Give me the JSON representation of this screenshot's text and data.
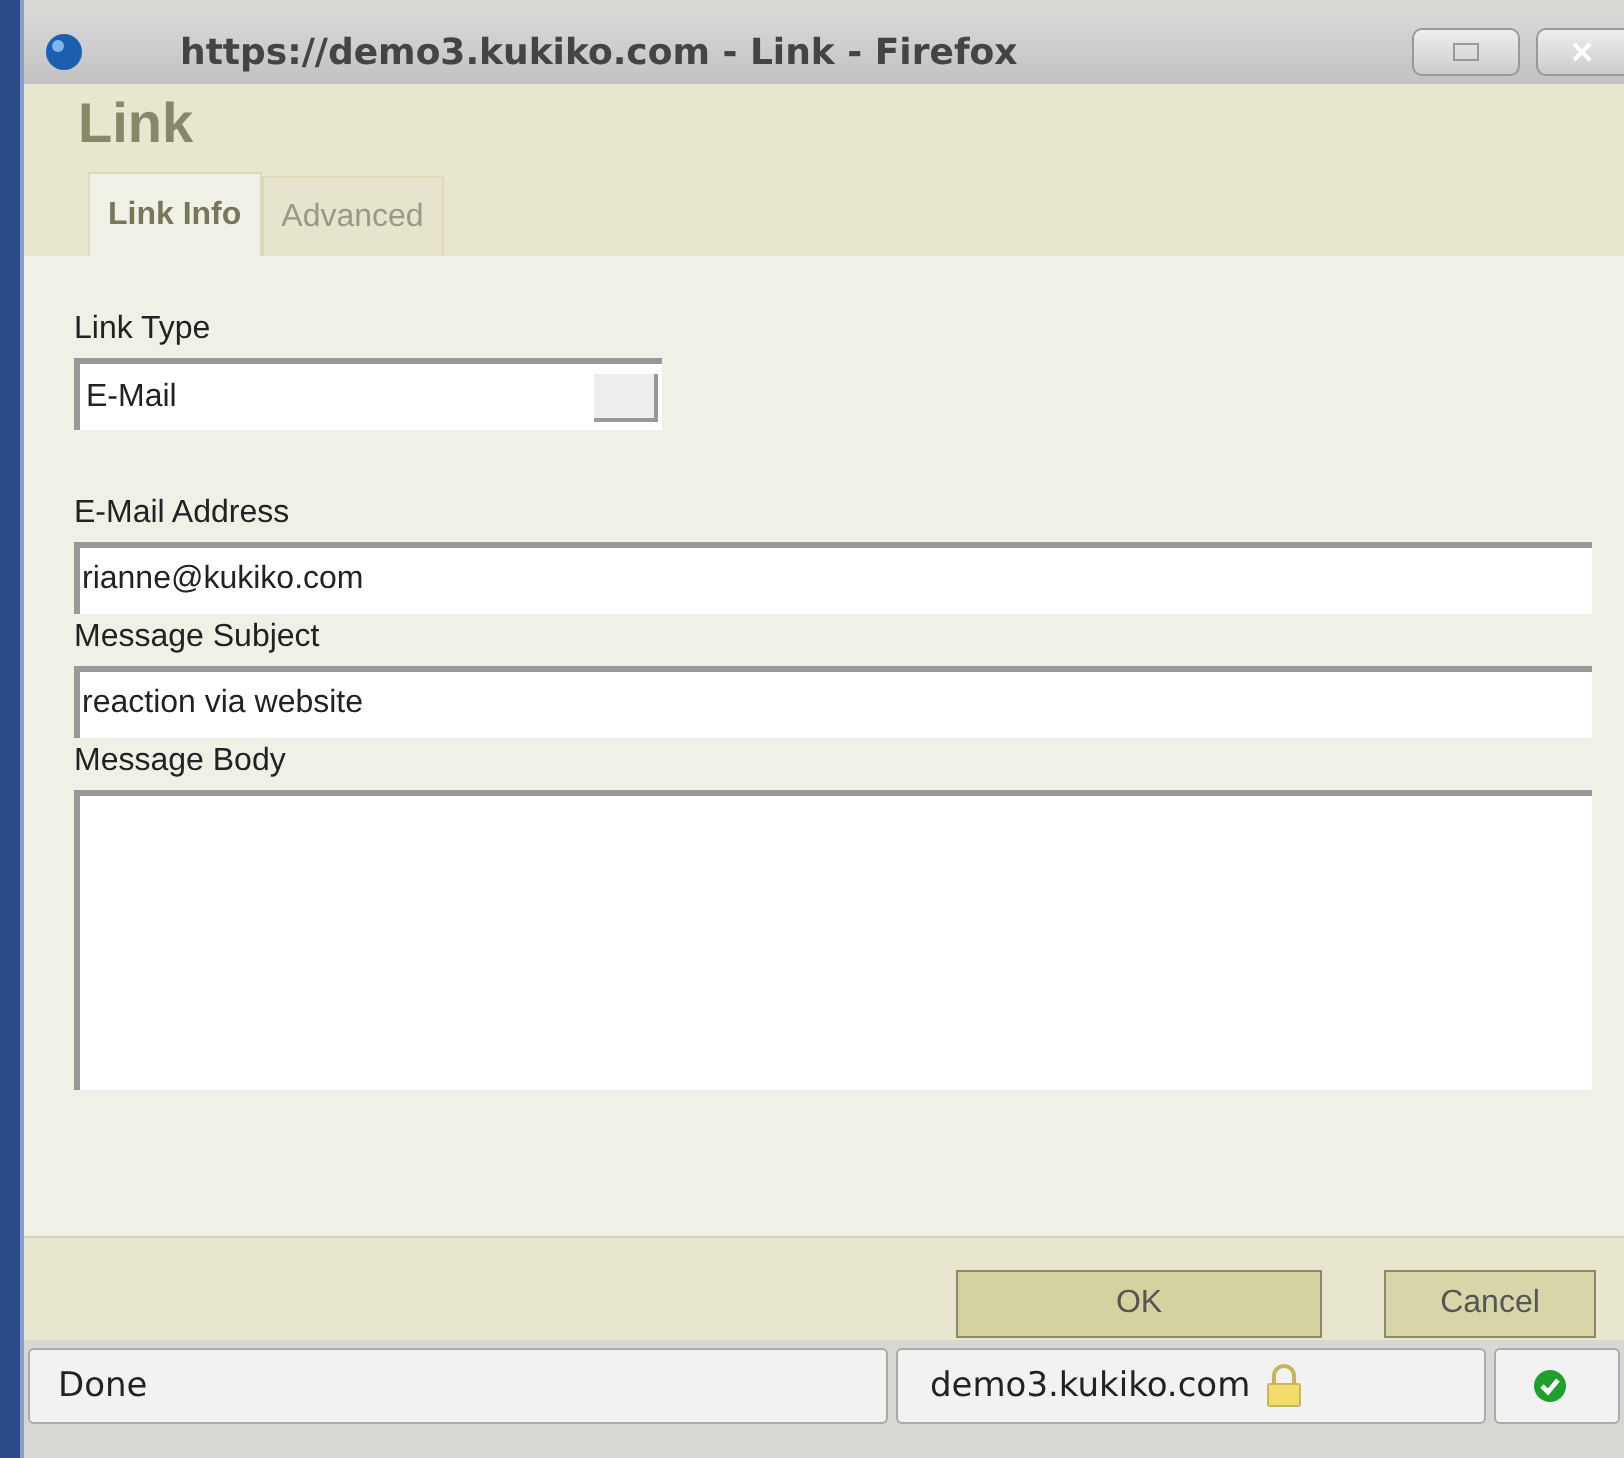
{
  "window": {
    "title": "https://demo3.kukiko.com - Link - Firefox"
  },
  "dialog": {
    "title": "Link"
  },
  "tabs": [
    {
      "label": "Link Info",
      "selected": true
    },
    {
      "label": "Advanced",
      "selected": false
    }
  ],
  "link_type": {
    "label": "Link Type",
    "value": "E-Mail"
  },
  "fields": [
    {
      "label": "E-Mail Address",
      "value": "rianne@kukiko.com",
      "kind": "input"
    },
    {
      "label": "Message Subject",
      "value": "reaction via website",
      "kind": "input"
    },
    {
      "label": "Message Body",
      "kind": "textarea"
    }
  ],
  "buttons": [
    {
      "label": "OK",
      "kind": "ok"
    },
    {
      "label": "Cancel",
      "kind": "cancel"
    }
  ],
  "status_bar": {
    "status": "Done",
    "host": "demo3.kukiko.com"
  }
}
